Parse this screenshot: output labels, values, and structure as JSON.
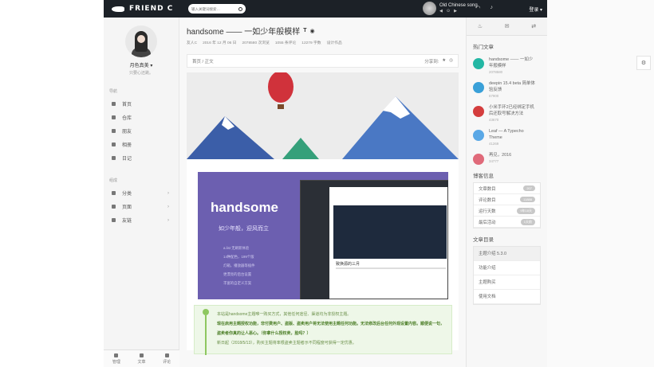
{
  "header": {
    "logo_text": "FRIEND C",
    "search_placeholder": "输入关键词搜索…",
    "music_title": "Old Chinese song",
    "music_controls": [
      "◀",
      "⊙",
      "▶"
    ],
    "login_label": "登录 ▾"
  },
  "sidebar": {
    "user_name": "月色真美 ▾",
    "user_sub": "只要心还跳。",
    "nav_section": "导航",
    "nav_items": [
      {
        "label": "首页"
      },
      {
        "label": "仓库"
      },
      {
        "label": "朋友"
      },
      {
        "label": "相册"
      },
      {
        "label": "日记"
      }
    ],
    "group_section": "组成",
    "group_items": [
      {
        "label": "分类"
      },
      {
        "label": "页面"
      },
      {
        "label": "友链"
      }
    ],
    "footer": [
      {
        "label": "管理"
      },
      {
        "label": "文章"
      },
      {
        "label": "评论"
      }
    ]
  },
  "post": {
    "title": "handsome —— 一如少年般模样",
    "meta": [
      "友人C",
      "2016 年 12 月 06 日",
      "2078580 次浏览",
      "1055 条评论",
      "12279 字数",
      "设计作品"
    ],
    "breadcrumb": [
      "首页",
      "正文"
    ],
    "share_label": "分享到:",
    "banner_title": "handsome",
    "banner_sub": "如少年般，迎风而立",
    "banner_list": [
      "a.list 无刷新体验",
      "14种配色，199个版",
      "灯箱，播放器等插件",
      "更漂亮的后台设置",
      "丰富的自定义方案"
    ],
    "shot_title": "致换源的三月",
    "notice": [
      "本站是handsome主题唯一购买方式，其他任何途径、渠道均为非授权主题。",
      "现在启用主题授权功能，非付费用户、盗版、盗卖用户将无法使用主题任何功能。无法修改后台任何外观设置内容。顺便说一句，盗卖者你真的让人恶心。（你拿什么授权卖，脸吗？）",
      "新日起（2018/5/13），购买主题将率根盗卖主题者示不同程度可获得一定优惠。"
    ]
  },
  "right": {
    "hot_header": "热门文章",
    "hot": [
      {
        "title": "handsome —— 一如少年般模样",
        "views": "2078580",
        "color": "#23b7a4"
      },
      {
        "title": "deepin 15.4 beta 简单体验反馈",
        "views": "67900",
        "color": "#3aa0d8"
      },
      {
        "title": "小米手环2已经绑定手机后还取号解决方法",
        "views": "43670",
        "color": "#d43d3d"
      },
      {
        "title": "Leaf — A Typecho Theme",
        "views": "41269",
        "color": "#5aa8e6"
      },
      {
        "title": "再见，2016",
        "views": "34777",
        "color": "#e06a7a"
      }
    ],
    "info_header": "博客信息",
    "info": [
      {
        "label": "文章数目",
        "badge": "207"
      },
      {
        "label": "评论数目",
        "badge": "11888"
      },
      {
        "label": "运行天数",
        "badge": "9年18天"
      },
      {
        "label": "最后活动",
        "badge": "1天前"
      }
    ],
    "toc_header": "文章目录",
    "toc": [
      "主题介绍 5.3.0",
      "功能介绍",
      "主题购买",
      "使用文档"
    ]
  }
}
